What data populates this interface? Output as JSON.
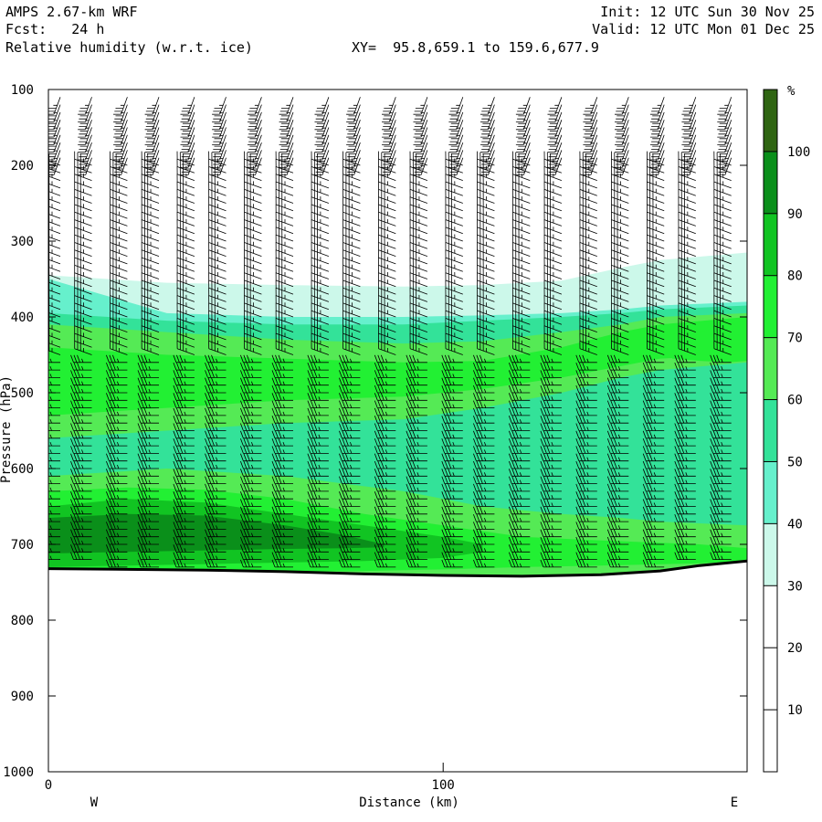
{
  "header": {
    "model": "AMPS 2.67-km WRF",
    "forecast": "Fcst:   24 h",
    "field": "Relative humidity (w.r.t. ice)",
    "xy_label": "XY=  95.8,659.1 to 159.6,677.9",
    "init": "Init: 12 UTC Sun 30 Nov 25",
    "valid": "Valid: 12 UTC Mon 01 Dec 25"
  },
  "colors": {
    "levels": [
      {
        "from": 30,
        "to": 40,
        "color": "#ccf8ea"
      },
      {
        "from": 40,
        "to": 50,
        "color": "#66f0cc"
      },
      {
        "from": 50,
        "to": 60,
        "color": "#33e299"
      },
      {
        "from": 60,
        "to": 70,
        "color": "#55ea55"
      },
      {
        "from": 70,
        "to": 80,
        "color": "#22f033"
      },
      {
        "from": 80,
        "to": 90,
        "color": "#11c422"
      },
      {
        "from": 90,
        "to": 100,
        "color": "#0a8f1a"
      },
      {
        "from": 100,
        "to": 110,
        "color": "#2f6512"
      }
    ]
  },
  "chart_data": {
    "type": "heatmap",
    "title": "Relative humidity (w.r.t. ice)",
    "xlabel": "Distance (km)",
    "ylabel": "Pressure (hPa)",
    "xlim": [
      0,
      177
    ],
    "ylim": [
      1000,
      100
    ],
    "x_ticks": [
      0,
      100
    ],
    "x_tick_labels": [
      "0",
      "100"
    ],
    "y_ticks": [
      100,
      200,
      300,
      400,
      500,
      600,
      700,
      800,
      900,
      1000
    ],
    "y_tick_labels": [
      "100",
      "200",
      "300",
      "400",
      "500",
      "600",
      "700",
      "800",
      "900",
      "1000"
    ],
    "x_end_labels": {
      "left": "W",
      "right": "E"
    },
    "colorbar": {
      "unit": "%",
      "ticks": [
        10,
        20,
        30,
        40,
        50,
        60,
        70,
        80,
        90,
        100
      ],
      "tick_labels": [
        "10",
        "20",
        "30",
        "40",
        "50",
        "60",
        "70",
        "80",
        "90",
        "100"
      ],
      "range": [
        0,
        110
      ]
    },
    "terrain_surface": {
      "distance_km": [
        0,
        20,
        40,
        60,
        80,
        100,
        120,
        140,
        155,
        165,
        177
      ],
      "pressure_hpa": [
        732,
        733,
        734,
        736,
        739,
        741,
        742,
        740,
        735,
        728,
        722
      ]
    },
    "rh_layers": [
      {
        "rh": 35,
        "distance_km": [
          0,
          30,
          60,
          90,
          110,
          130,
          145,
          155,
          177
        ],
        "top_hpa": [
          345,
          355,
          358,
          360,
          358,
          352,
          335,
          325,
          315
        ],
        "bottom_hpa": [
          732,
          733,
          736,
          739,
          741,
          742,
          740,
          735,
          722
        ]
      },
      {
        "rh": 45,
        "distance_km": [
          0,
          30,
          60,
          90,
          110,
          130,
          145,
          155,
          177
        ],
        "top_hpa": [
          350,
          395,
          400,
          400,
          398,
          395,
          390,
          385,
          380
        ],
        "bottom_hpa": [
          732,
          733,
          736,
          739,
          741,
          742,
          740,
          735,
          722
        ]
      },
      {
        "rh": 55,
        "distance_km": [
          0,
          30,
          60,
          90,
          110,
          130,
          145,
          155,
          177
        ],
        "top_hpa": [
          395,
          405,
          410,
          410,
          405,
          400,
          395,
          390,
          385
        ],
        "bottom_hpa": [
          732,
          733,
          736,
          739,
          741,
          742,
          740,
          735,
          722
        ]
      },
      {
        "rh": 65,
        "distance_km": [
          0,
          30,
          60,
          90,
          110,
          130,
          145,
          155,
          177
        ],
        "top_hpa": [
          410,
          420,
          430,
          435,
          432,
          420,
          410,
          400,
          395
        ],
        "bottom_hpa": [
          560,
          550,
          540,
          535,
          520,
          500,
          480,
          470,
          460
        ]
      },
      {
        "rh": 75,
        "distance_km": [
          0,
          30,
          60,
          90,
          110,
          130,
          145,
          155,
          177
        ],
        "top_hpa": [
          440,
          450,
          455,
          460,
          458,
          440,
          420,
          410,
          400
        ],
        "bottom_hpa": [
          530,
          520,
          510,
          505,
          495,
          480,
          465,
          455,
          450
        ]
      },
      {
        "rh": 65,
        "distance_km": [
          0,
          30,
          60,
          90,
          110,
          130,
          145,
          155,
          177
        ],
        "top_hpa": [
          610,
          600,
          610,
          630,
          650,
          660,
          665,
          670,
          675
        ],
        "bottom_hpa": [
          732,
          733,
          736,
          739,
          741,
          742,
          740,
          735,
          722
        ]
      },
      {
        "rh": 75,
        "distance_km": [
          0,
          20,
          40,
          60,
          80,
          100,
          120,
          140,
          165,
          177
        ],
        "top_hpa": [
          630,
          625,
          628,
          640,
          660,
          675,
          690,
          695,
          700,
          705
        ],
        "bottom_hpa": [
          732,
          733,
          734,
          736,
          735,
          733,
          730,
          728,
          725,
          722
        ]
      },
      {
        "rh": 85,
        "distance_km": [
          0,
          20,
          40,
          60,
          80,
          100,
          110
        ],
        "top_hpa": [
          650,
          640,
          645,
          660,
          675,
          690,
          700
        ],
        "bottom_hpa": [
          730,
          728,
          726,
          724,
          722,
          718,
          710
        ]
      },
      {
        "rh": 95,
        "distance_km": [
          0,
          20,
          40,
          60,
          75,
          85
        ],
        "top_hpa": [
          665,
          660,
          662,
          675,
          688,
          700
        ],
        "bottom_hpa": [
          712,
          710,
          708,
          706,
          705,
          704
        ]
      },
      {
        "rh": 75,
        "distance_km": [
          158,
          165,
          172,
          177
        ],
        "top_hpa": [
          430,
          420,
          410,
          405
        ],
        "bottom_hpa": [
          455,
          458,
          460,
          458
        ]
      }
    ],
    "wind_barbs": {
      "columns_km": [
        3,
        11,
        20,
        28,
        37,
        45,
        54,
        62,
        71,
        79,
        88,
        96,
        105,
        113,
        122,
        130,
        139,
        147,
        156,
        164,
        173
      ],
      "levels_hpa": [
        110,
        120,
        130,
        140,
        150,
        160,
        170,
        180,
        190,
        200,
        210,
        220,
        230,
        240,
        250,
        260,
        270,
        280,
        290,
        300,
        310,
        320,
        330,
        340,
        350,
        360,
        370,
        380,
        390,
        400,
        410,
        420,
        430,
        440,
        450,
        460,
        470,
        480,
        490,
        500,
        510,
        520,
        530,
        540,
        550,
        560,
        570,
        580,
        590,
        600,
        610,
        620,
        630,
        640,
        650,
        660,
        670,
        680,
        690,
        700,
        710,
        720,
        730
      ],
      "direction_deg": {
        "upper_100_190": 200,
        "mid_200_450": 290,
        "lower_460_720": 270
      },
      "speed_kt": 25
    }
  }
}
